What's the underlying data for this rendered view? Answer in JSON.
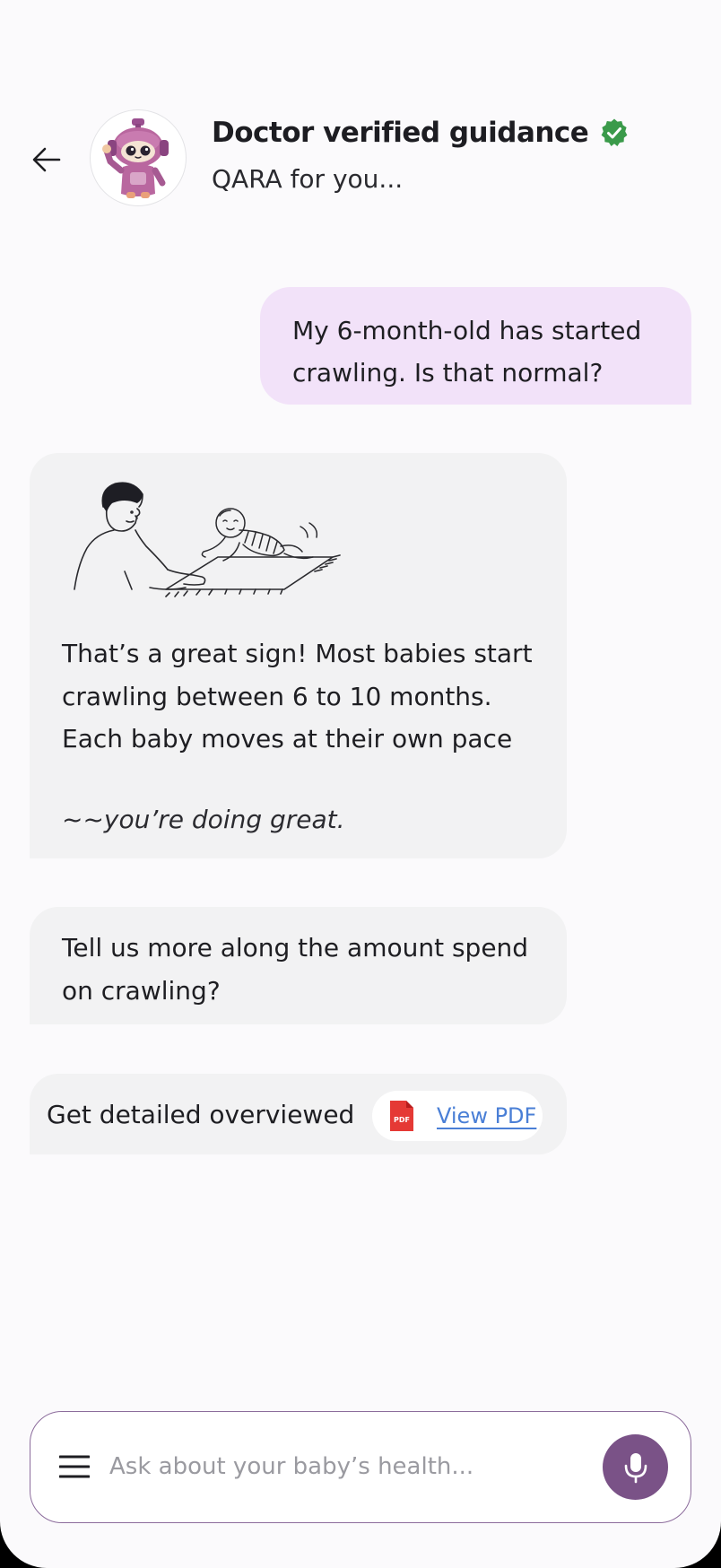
{
  "header": {
    "title": "Doctor verified guidance",
    "subtitle": "QARA for you...",
    "back_icon": "arrow-left-icon",
    "verified_icon": "verified-badge-icon",
    "avatar": "robot-mascot"
  },
  "messages": {
    "user_question": "My 6-month-old has started crawling. Is that normal?",
    "answer": {
      "illustration": "parent-watching-baby-crawl",
      "text": "That’s a great sign! Most babies start crawling between 6 to 10 months. Each baby moves at their own pace",
      "tagline": "~~you’re doing great."
    },
    "follow_up": "Tell us more along the amount spend on crawling?",
    "pdf_card": {
      "label": "Get detailed overviewed",
      "icon": "pdf-file-icon",
      "icon_text": "PDF",
      "link_label": "View PDF"
    }
  },
  "composer": {
    "placeholder": "Ask about your baby’s health...",
    "value": "",
    "menu_icon": "hamburger-menu-icon",
    "mic_icon": "microphone-icon"
  },
  "colors": {
    "user_bubble": "#f2e2f9",
    "bot_bubble": "#f2f2f3",
    "accent": "#7a5287",
    "verified": "#3a9a4a",
    "link": "#4a7fd6",
    "pdf_red": "#e53935"
  }
}
